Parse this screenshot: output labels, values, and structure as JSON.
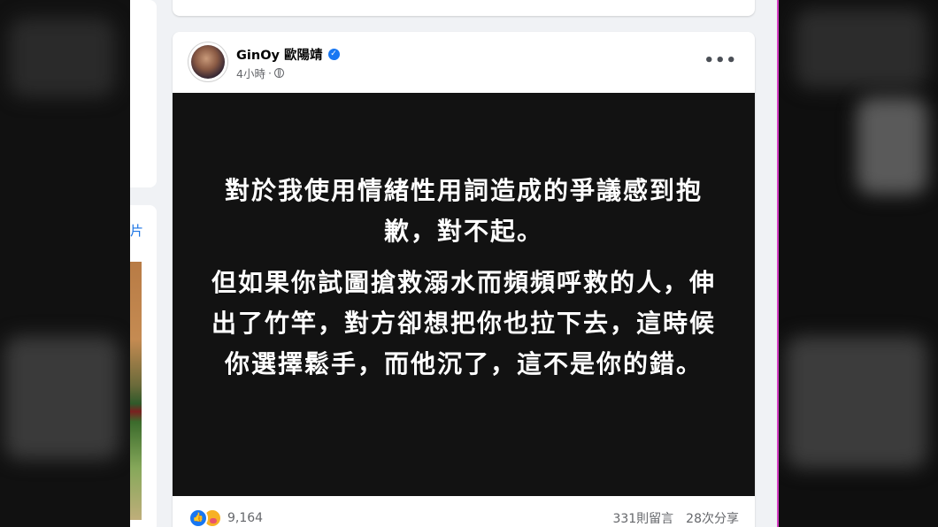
{
  "side": {
    "label": "片"
  },
  "post": {
    "author": "GinOy 歐陽靖",
    "timestamp": "4小時",
    "separator": "·",
    "image_text": {
      "paragraph1": "對於我使用情緒性用詞造成的爭議感到抱歉，對不起。",
      "paragraph2": "但如果你試圖搶救溺水而頻頻呼救的人，伸出了竹竿，對方卻想把你也拉下去，這時候你選擇鬆手，而他沉了，這不是你的錯。"
    },
    "reactions_count": "9,164",
    "comments": "331則留言",
    "shares": "28次分享",
    "more_label": "•••",
    "verified_glyph": "✓",
    "like_glyph": "👍"
  },
  "colors": {
    "accent": "#1877f2",
    "image_background": "#121212",
    "feed_background": "#f0f2f5"
  },
  "icons": [
    "verified-badge-icon",
    "globe-icon",
    "more-options-icon",
    "like-reaction-icon",
    "care-reaction-icon"
  ]
}
